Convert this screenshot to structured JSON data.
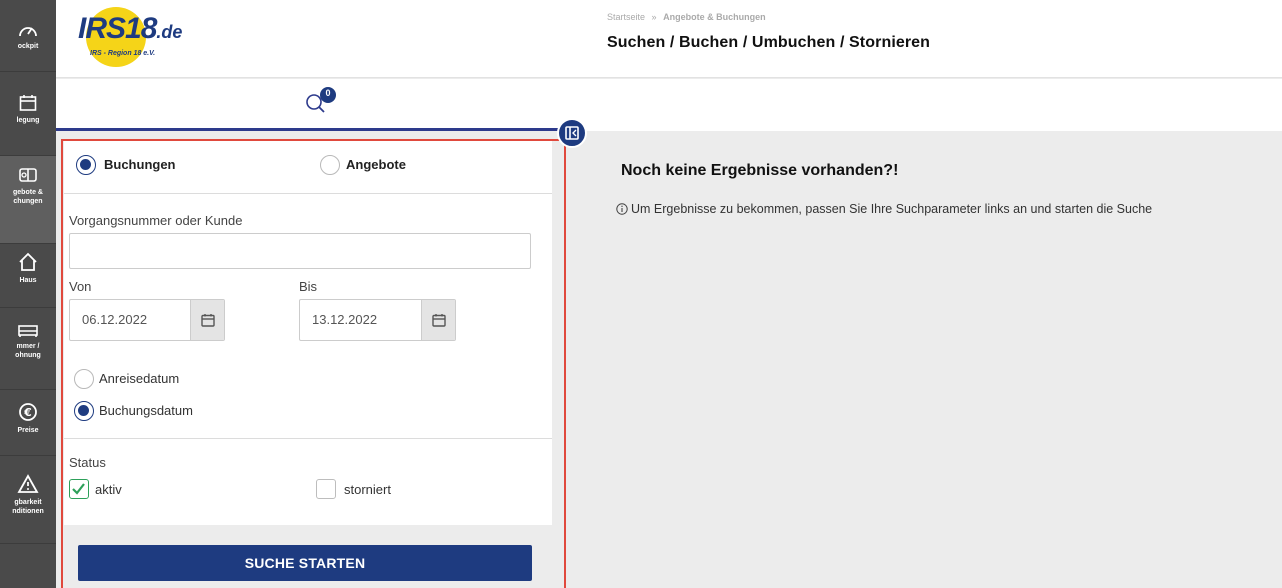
{
  "rail": {
    "items": [
      {
        "label": "ockpit",
        "icon": "gauge-icon"
      },
      {
        "label": "legung",
        "icon": "calendar-icon"
      },
      {
        "label": "gebote &\nchungen",
        "icon": "offers-icon"
      },
      {
        "label": "Haus",
        "icon": "house-icon"
      },
      {
        "label": "mmer /\nohnung",
        "icon": "bed-icon"
      },
      {
        "label": "Preise",
        "icon": "euro-icon"
      },
      {
        "label": "gbarkeit\nnditionen",
        "icon": "warning-icon"
      }
    ]
  },
  "header": {
    "logo_main": "IRS18",
    "logo_tld": ".de",
    "logo_sub": "IRS - Region 18 e.V.",
    "breadcrumb_home": "Startseite",
    "breadcrumb_sep": "»",
    "breadcrumb_current": "Angebote & Buchungen",
    "title": "Suchen / Buchen / Umbuchen / Stornieren"
  },
  "subbar": {
    "search_badge_count": "0"
  },
  "form": {
    "type_options": [
      {
        "label": "Buchungen",
        "checked": true
      },
      {
        "label": "Angebote",
        "checked": false
      }
    ],
    "query_label": "Vorgangsnummer oder Kunde",
    "query_value": "",
    "from_label": "Von",
    "from_value": "06.12.2022",
    "to_label": "Bis",
    "to_value": "13.12.2022",
    "date_type_options": [
      {
        "label": "Anreisedatum",
        "checked": false
      },
      {
        "label": "Buchungsdatum",
        "checked": true
      }
    ],
    "status_label": "Status",
    "status_options": [
      {
        "label": "aktiv",
        "checked": true
      },
      {
        "label": "storniert",
        "checked": false
      }
    ],
    "submit_label": "SUCHE STARTEN"
  },
  "results": {
    "title": "Noch keine Ergebnisse vorhanden?!",
    "hint": "Um Ergebnisse zu bekommen, passen Sie Ihre Suchparameter links an und starten die Suche"
  },
  "colors": {
    "primary": "#1e3b80",
    "highlight": "#e0493d",
    "check": "#2da05a",
    "rail": "#4a4a4a",
    "logo_yellow": "#f5d418"
  }
}
